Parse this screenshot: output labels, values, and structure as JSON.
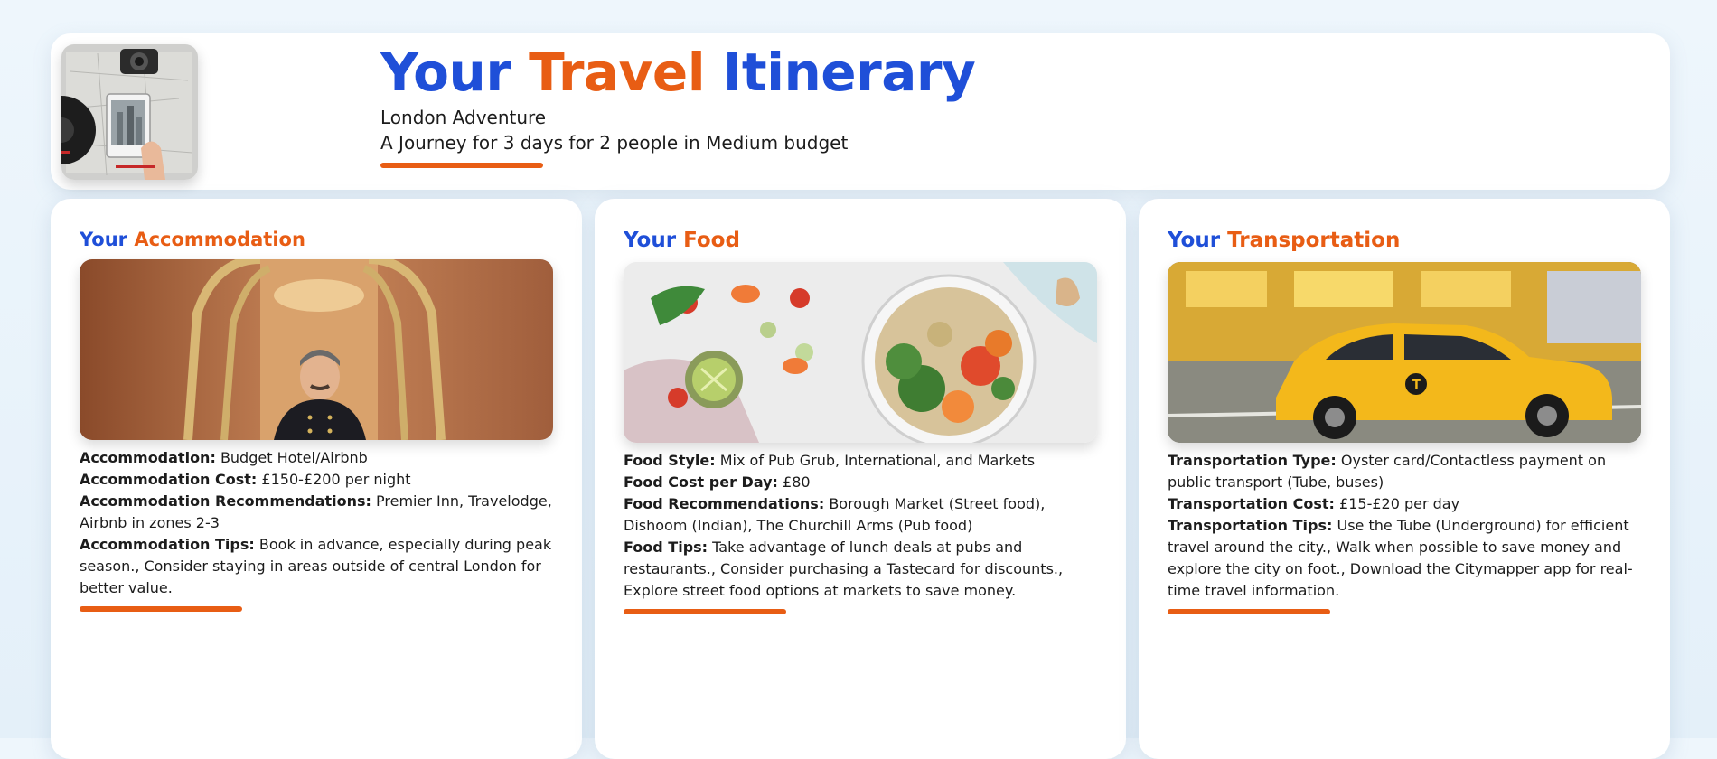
{
  "header": {
    "title_part1": "Your",
    "title_part2": "Travel",
    "title_part3": "Itinerary",
    "subtitle": "London Adventure",
    "tagline": "A Journey for 3 days for 2 people in Medium budget",
    "thumbnail_icon": "travel-map-camera-image"
  },
  "colors": {
    "accent_blue": "#1f4fd8",
    "accent_orange": "#e85d14"
  },
  "accommodation": {
    "title_prefix": "Your",
    "title_topic": "Accommodation",
    "image_icon": "hotel-bellhop-image",
    "fields": [
      {
        "label": "Accommodation:",
        "value": "Budget Hotel/Airbnb"
      },
      {
        "label": "Accommodation Cost:",
        "value": "£150-£200 per night"
      },
      {
        "label": "Accommodation Recommendations:",
        "value": "Premier Inn, Travelodge, Airbnb in zones 2-3"
      },
      {
        "label": "Accommodation Tips:",
        "value": "Book in advance, especially during peak season., Consider staying in areas outside of central London for better value."
      }
    ]
  },
  "food": {
    "title_prefix": "Your",
    "title_topic": "Food",
    "image_icon": "salad-bowl-image",
    "fields": [
      {
        "label": "Food Style:",
        "value": "Mix of Pub Grub, International, and Markets"
      },
      {
        "label": "Food Cost per Day:",
        "value": "£80"
      },
      {
        "label": "Food Recommendations:",
        "value": "Borough Market (Street food), Dishoom (Indian), The Churchill Arms (Pub food)"
      },
      {
        "label": "Food Tips:",
        "value": "Take advantage of lunch deals at pubs and restaurants., Consider purchasing a Tastecard for discounts., Explore street food options at markets to save money."
      }
    ]
  },
  "transportation": {
    "title_prefix": "Your",
    "title_topic": "Transportation",
    "image_icon": "yellow-taxi-image",
    "fields": [
      {
        "label": "Transportation Type:",
        "value": "Oyster card/Contactless payment on public transport (Tube, buses)"
      },
      {
        "label": "Transportation Cost:",
        "value": "£15-£20 per day"
      },
      {
        "label": "Transportation Tips:",
        "value": "Use the Tube (Underground) for efficient travel around the city., Walk when possible to save money and explore the city on foot., Download the Citymapper app for real-time travel information."
      }
    ]
  }
}
